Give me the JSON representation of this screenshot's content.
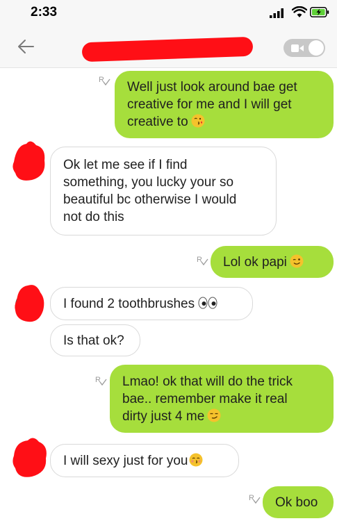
{
  "status_bar": {
    "time": "2:33"
  },
  "header": {
    "contact_name": ""
  },
  "messages": [
    {
      "lines": [
        "Well just look around bae get",
        "creative for me and I will get",
        "creative to"
      ]
    },
    {
      "lines": [
        "Ok let me see if I find",
        "something, you lucky your so",
        "beautiful bc otherwise I would",
        "not do this"
      ]
    },
    {
      "lines": [
        "Lol ok papi"
      ]
    },
    {
      "lines": [
        "I found 2 toothbrushes"
      ]
    },
    {
      "lines": [
        "Is that ok?"
      ]
    },
    {
      "lines": [
        "Lmao! ok that will do the trick",
        "bae.. remember make it real",
        "dirty just 4 me"
      ]
    },
    {
      "lines": [
        "I will sexy just for you"
      ]
    },
    {
      "lines": [
        "Ok boo"
      ]
    }
  ],
  "colors": {
    "sent_bubble": "#a6de3c",
    "received_border": "#d9d9d9",
    "redaction": "#ff0f16"
  },
  "icons": [
    "back-arrow-icon",
    "video-camera-icon",
    "read-receipt-icon",
    "kiss-emoji-icon",
    "wink-emoji-icon",
    "eyes-emoji-icon",
    "smirk-emoji-icon"
  ]
}
